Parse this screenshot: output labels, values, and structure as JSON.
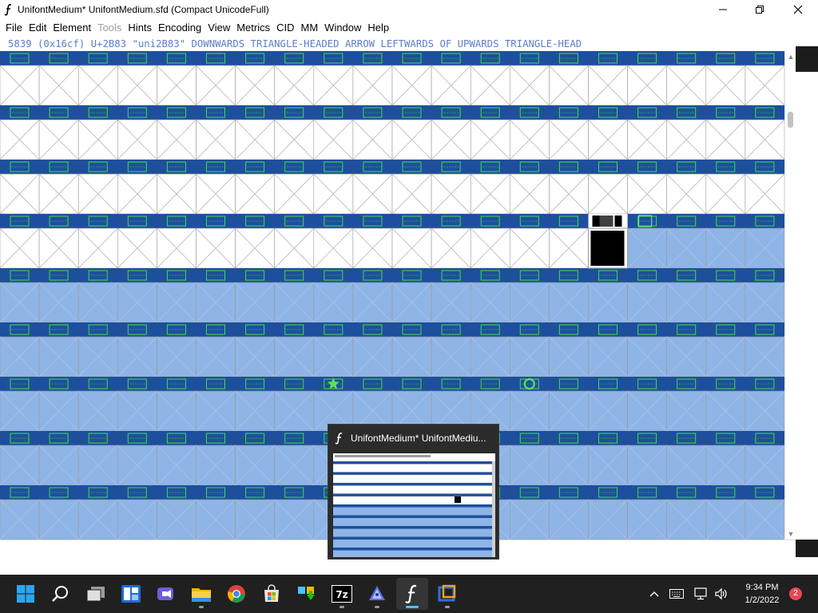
{
  "window": {
    "title": "UnifontMedium*  UnifontMedium.sfd (Compact UnicodeFull)"
  },
  "menu": {
    "items": [
      {
        "label": "File",
        "disabled": false
      },
      {
        "label": "Edit",
        "disabled": false
      },
      {
        "label": "Element",
        "disabled": false
      },
      {
        "label": "Tools",
        "disabled": true
      },
      {
        "label": "Hints",
        "disabled": false
      },
      {
        "label": "Encoding",
        "disabled": false
      },
      {
        "label": "View",
        "disabled": false
      },
      {
        "label": "Metrics",
        "disabled": false
      },
      {
        "label": "CID",
        "disabled": false
      },
      {
        "label": "MM",
        "disabled": false
      },
      {
        "label": "Window",
        "disabled": false
      },
      {
        "label": "Help",
        "disabled": false
      }
    ]
  },
  "info_line": "5839 (0x16cf) U+2B83 \"uni2B83\" DOWNWARDS TRIANGLE-HEADED ARROW LEFTWARDS OF UPWARDS TRIANGLE-HEAD",
  "grid": {
    "columns": 20,
    "rows": 9,
    "header_color": "#1e4f9c",
    "label_color": "#39e04a",
    "empty_cell_color": "#ffffff",
    "unmapped_cell_color": "#8fb5e6",
    "selected_glyph": "uni2B83"
  },
  "preview": {
    "title": "UnifontMedium*  UnifontMediu..."
  },
  "taskbar": {
    "apps": [
      "start",
      "search",
      "task-view",
      "widgets",
      "teams-chat",
      "file-explorer",
      "chrome",
      "store",
      "app-installer",
      "7zip",
      "inkscape",
      "fontforge",
      "virtualbox"
    ],
    "time": "9:34 PM",
    "date": "1/2/2022",
    "notification_count": "2"
  }
}
